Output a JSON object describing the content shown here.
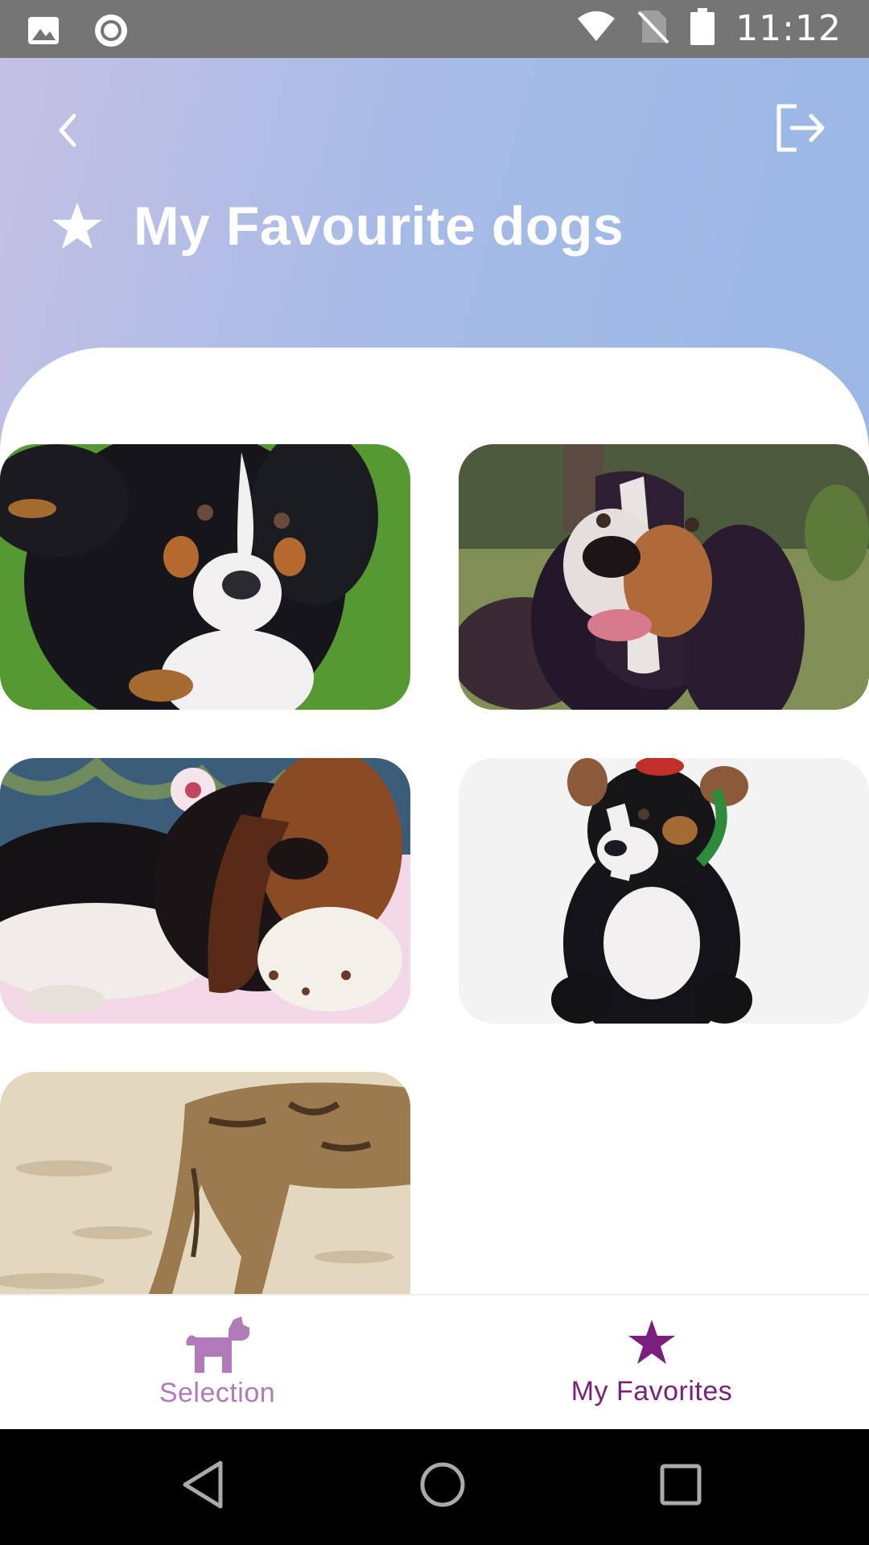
{
  "status_bar": {
    "time": "11:12",
    "icons": [
      "image-icon",
      "circle-record-icon",
      "wifi-icon",
      "no-sim-icon",
      "battery-icon"
    ]
  },
  "header": {
    "title": "My Favourite dogs",
    "back_icon": "chevron-left-icon",
    "logout_icon": "logout-icon",
    "title_icon": "star-icon"
  },
  "favorites": [
    {
      "name": "dog-photo-bernese-puppy-grass"
    },
    {
      "name": "dog-photo-basset-hound-park"
    },
    {
      "name": "dog-photo-basset-hound-lying"
    },
    {
      "name": "dog-photo-bernese-snow"
    },
    {
      "name": "dog-photo-brindle-dog-sand"
    }
  ],
  "bottom_nav": {
    "items": [
      {
        "label": "Selection",
        "icon": "dog-icon",
        "active": false
      },
      {
        "label": "My Favorites",
        "icon": "star-icon",
        "active": true
      }
    ]
  },
  "colors": {
    "header_gradient_start": "#c5c0e4",
    "header_gradient_end": "#9ab7e5",
    "active_nav": "#7a1f7e",
    "inactive_nav": "#b07bb8",
    "status_bar": "#757575"
  }
}
